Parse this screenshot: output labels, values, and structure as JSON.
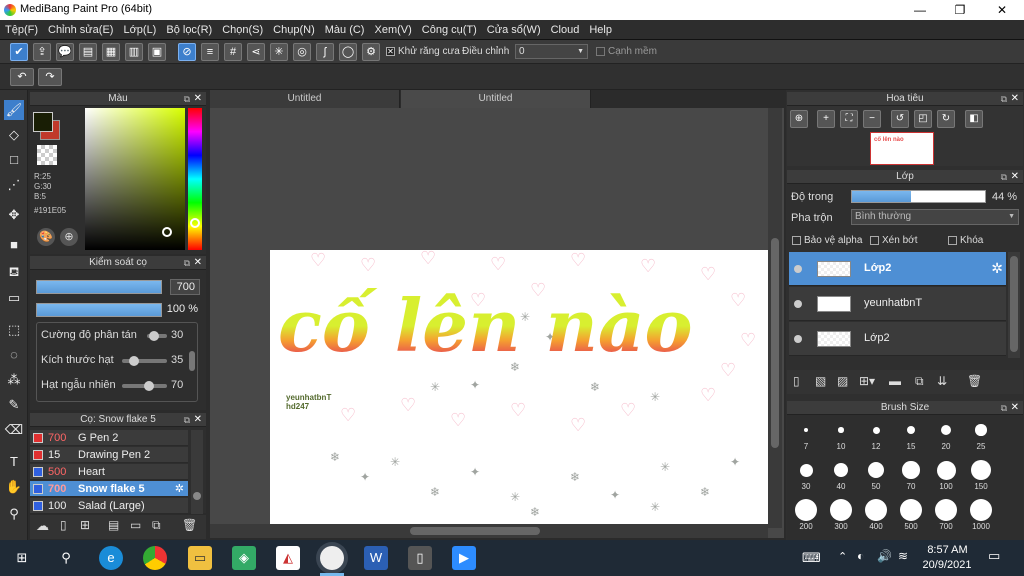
{
  "window": {
    "title": "MediBang Paint Pro (64bit)",
    "minimize": "—",
    "maximize": "❐",
    "close": "✕"
  },
  "menu": [
    "Tệp(F)",
    "Chỉnh sửa(E)",
    "Lớp(L)",
    "Bộ lọc(R)",
    "Chọn(S)",
    "Chụp(N)",
    "Màu (C)",
    "Xem(V)",
    "Công cụ(T)",
    "Cửa sổ(W)",
    "Cloud",
    "Help"
  ],
  "toolbar": {
    "antialias_label": "Khử răng cưa",
    "adjust_label": "Điều chỉnh",
    "adjust_value": "0",
    "soft_edge_label": "Cạnh mềm"
  },
  "color_panel": {
    "title": "Màu",
    "r": "R:25",
    "g": "G:30",
    "b": "B:5",
    "hex": "#191E05",
    "main_color": "#191E05",
    "accent": "#c0392b"
  },
  "brush_control": {
    "title": "Kiểm soát cọ",
    "size": "700",
    "opacity": "100 %",
    "scatter_label": "Cường độ phân tán",
    "scatter_value": "30",
    "particle_label": "Kích thước hạt",
    "particle_value": "35",
    "random_label": "Hạt ngẫu nhiên",
    "random_value": "70"
  },
  "brush_list": {
    "title": "Cọ: Snow flake 5",
    "items": [
      {
        "size": "700",
        "name": "G Pen 2",
        "color": "#e03030"
      },
      {
        "size": "15",
        "name": "Drawing Pen 2",
        "color": "#e03030"
      },
      {
        "size": "500",
        "name": "Heart",
        "color": "#3060e0"
      },
      {
        "size": "700",
        "name": "Snow flake 5",
        "color": "#3060e0"
      },
      {
        "size": "100",
        "name": "Salad (Large)",
        "color": "#3060e0"
      }
    ]
  },
  "tabs": [
    "Untitled",
    "Untitled"
  ],
  "canvas": {
    "title_text": "cố lên nào",
    "signature_line1": "yeunhatbnT",
    "signature_line2": "hd247"
  },
  "navigator": {
    "title": "Hoa tiêu"
  },
  "layers": {
    "title": "Lớp",
    "opacity_label": "Độ trong",
    "opacity_value": "44 %",
    "opacity": 0.44,
    "blend_label": "Pha trộn",
    "blend_value": "Bình thường",
    "alpha_label": "Bảo vệ alpha",
    "clip_label": "Xén bớt",
    "lock_label": "Khóa",
    "items": [
      {
        "name": "Lớp2"
      },
      {
        "name": "yeunhatbnT"
      },
      {
        "name": "Lớp2"
      }
    ]
  },
  "brush_size": {
    "title": "Brush Size",
    "sizes": [
      "7",
      "10",
      "12",
      "15",
      "20",
      "25",
      "30",
      "40",
      "50",
      "70",
      "100",
      "150",
      "200",
      "300",
      "400",
      "500",
      "700",
      "1000"
    ]
  },
  "taskbar": {
    "time": "8:57 AM",
    "date": "20/9/2021"
  }
}
